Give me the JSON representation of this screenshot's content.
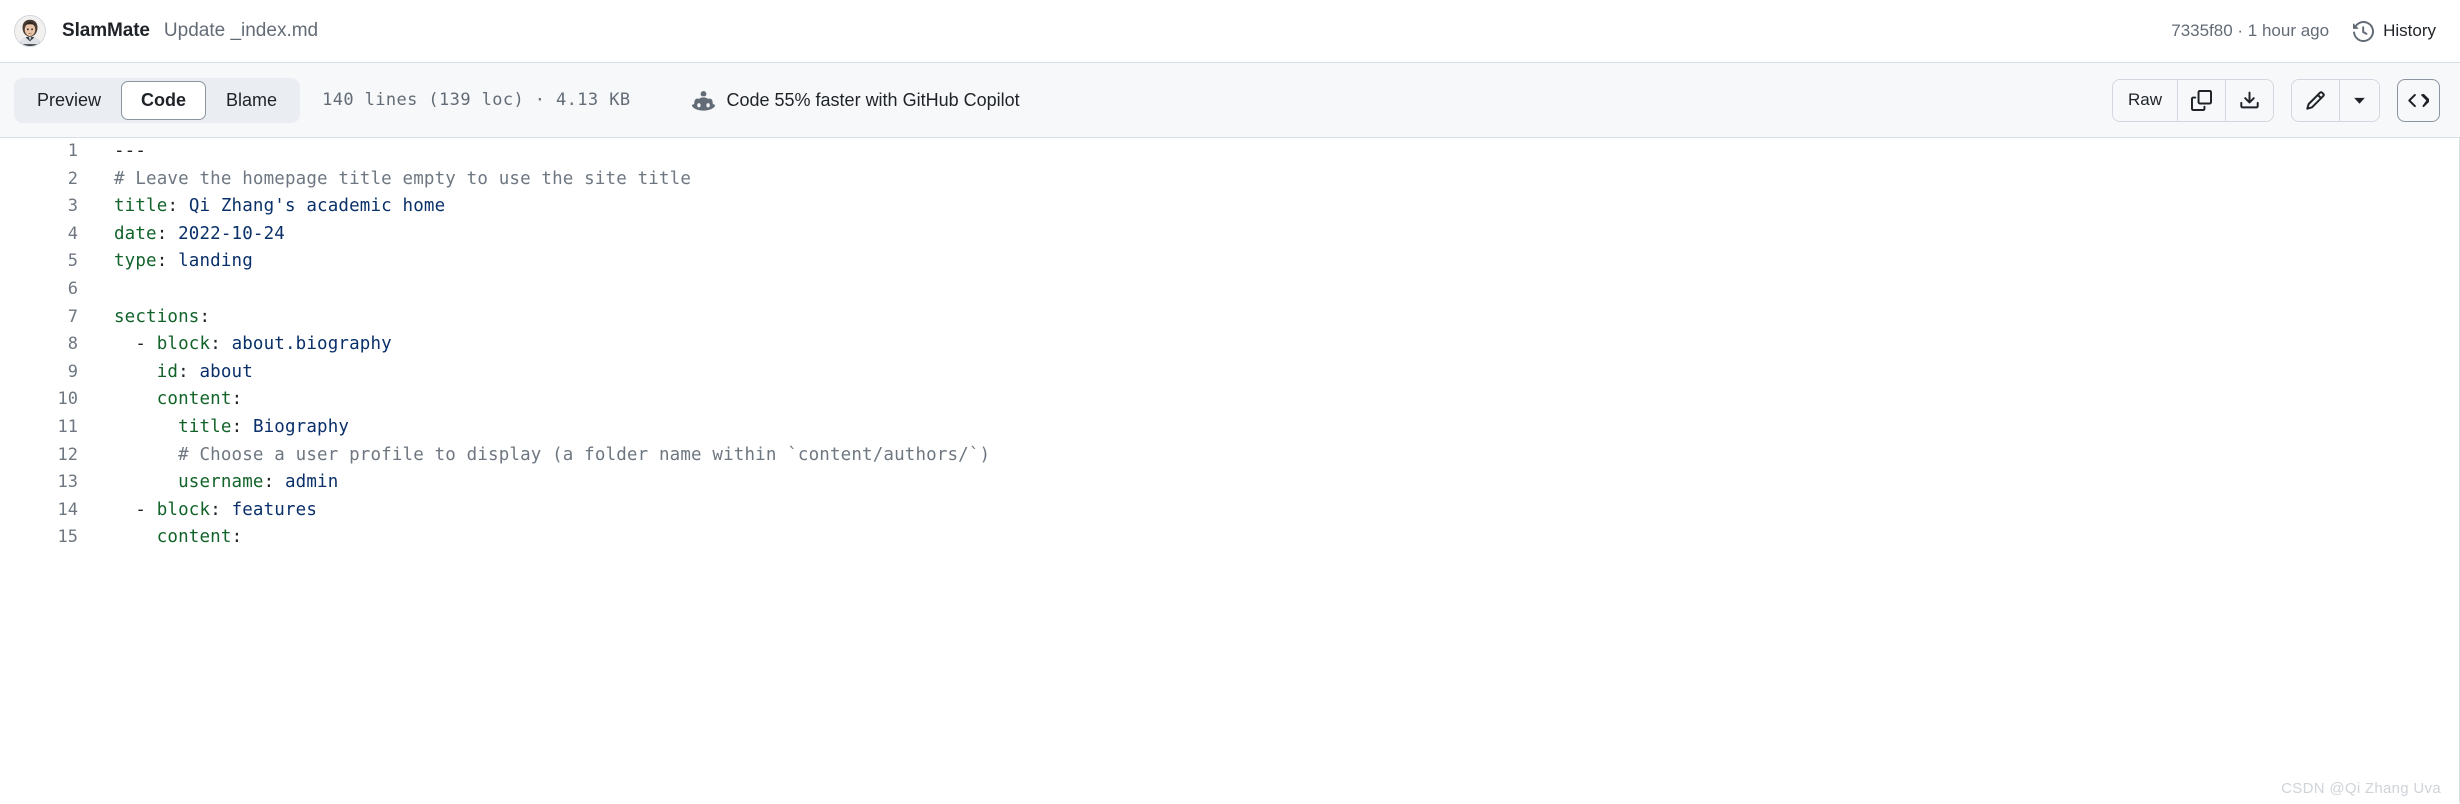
{
  "header": {
    "author": "SlamMate",
    "commit_message": "Update _index.md",
    "commit_meta": "7335f80 · 1 hour ago",
    "history_label": "History",
    "avatar_name": "user-avatar",
    "history_icon": "history-icon"
  },
  "toolbar": {
    "tabs": [
      {
        "label": "Preview",
        "active": false
      },
      {
        "label": "Code",
        "active": true
      },
      {
        "label": "Blame",
        "active": false
      }
    ],
    "file_stats": "140 lines (139 loc) · 4.13 KB",
    "copilot_text": "Code 55% faster with GitHub Copilot",
    "copilot_icon": "copilot-icon",
    "raw_label": "Raw",
    "copy_icon": "copy-icon",
    "download_icon": "download-icon",
    "edit_icon": "pencil-icon",
    "caret_icon": "chevron-down-icon",
    "symbols_icon": "code-brackets-icon"
  },
  "code": {
    "lines": [
      {
        "n": "1",
        "tokens": [
          {
            "t": "---",
            "c": "pl-p"
          }
        ]
      },
      {
        "n": "2",
        "tokens": [
          {
            "t": "# Leave the homepage title empty to use the site title",
            "c": "pl-c"
          }
        ]
      },
      {
        "n": "3",
        "tokens": [
          {
            "t": "title",
            "c": "pl-k"
          },
          {
            "t": ": ",
            "c": "pl-p"
          },
          {
            "t": "Qi Zhang's academic home",
            "c": "pl-s"
          }
        ]
      },
      {
        "n": "4",
        "tokens": [
          {
            "t": "date",
            "c": "pl-k"
          },
          {
            "t": ": ",
            "c": "pl-p"
          },
          {
            "t": "2022-10-24",
            "c": "pl-s"
          }
        ]
      },
      {
        "n": "5",
        "tokens": [
          {
            "t": "type",
            "c": "pl-k"
          },
          {
            "t": ": ",
            "c": "pl-p"
          },
          {
            "t": "landing",
            "c": "pl-s"
          }
        ]
      },
      {
        "n": "6",
        "tokens": [
          {
            "t": "",
            "c": "pl-p"
          }
        ]
      },
      {
        "n": "7",
        "tokens": [
          {
            "t": "sections",
            "c": "pl-k"
          },
          {
            "t": ":",
            "c": "pl-p"
          }
        ]
      },
      {
        "n": "8",
        "tokens": [
          {
            "t": "  - ",
            "c": "pl-p"
          },
          {
            "t": "block",
            "c": "pl-k"
          },
          {
            "t": ": ",
            "c": "pl-p"
          },
          {
            "t": "about.biography",
            "c": "pl-s"
          }
        ]
      },
      {
        "n": "9",
        "tokens": [
          {
            "t": "    ",
            "c": "pl-p"
          },
          {
            "t": "id",
            "c": "pl-k"
          },
          {
            "t": ": ",
            "c": "pl-p"
          },
          {
            "t": "about",
            "c": "pl-s"
          }
        ]
      },
      {
        "n": "10",
        "tokens": [
          {
            "t": "    ",
            "c": "pl-p"
          },
          {
            "t": "content",
            "c": "pl-k"
          },
          {
            "t": ":",
            "c": "pl-p"
          }
        ]
      },
      {
        "n": "11",
        "tokens": [
          {
            "t": "      ",
            "c": "pl-p"
          },
          {
            "t": "title",
            "c": "pl-k"
          },
          {
            "t": ": ",
            "c": "pl-p"
          },
          {
            "t": "Biography",
            "c": "pl-s"
          }
        ]
      },
      {
        "n": "12",
        "tokens": [
          {
            "t": "      # Choose a user profile to display (a folder name within `content/authors/`)",
            "c": "pl-c"
          }
        ]
      },
      {
        "n": "13",
        "tokens": [
          {
            "t": "      ",
            "c": "pl-p"
          },
          {
            "t": "username",
            "c": "pl-k"
          },
          {
            "t": ": ",
            "c": "pl-p"
          },
          {
            "t": "admin",
            "c": "pl-s"
          }
        ]
      },
      {
        "n": "14",
        "tokens": [
          {
            "t": "  - ",
            "c": "pl-p"
          },
          {
            "t": "block",
            "c": "pl-k"
          },
          {
            "t": ": ",
            "c": "pl-p"
          },
          {
            "t": "features",
            "c": "pl-s"
          }
        ]
      },
      {
        "n": "15",
        "tokens": [
          {
            "t": "    ",
            "c": "pl-p"
          },
          {
            "t": "content",
            "c": "pl-k"
          },
          {
            "t": ":",
            "c": "pl-p"
          }
        ]
      }
    ]
  },
  "watermark": "CSDN @Qi Zhang Uva",
  "colors": {
    "toolbar_bg": "#f6f8fa",
    "border": "#d8dee4",
    "key": "#116329",
    "value": "#0a3069",
    "comment": "#6e7781",
    "muted_text": "#636c76"
  }
}
